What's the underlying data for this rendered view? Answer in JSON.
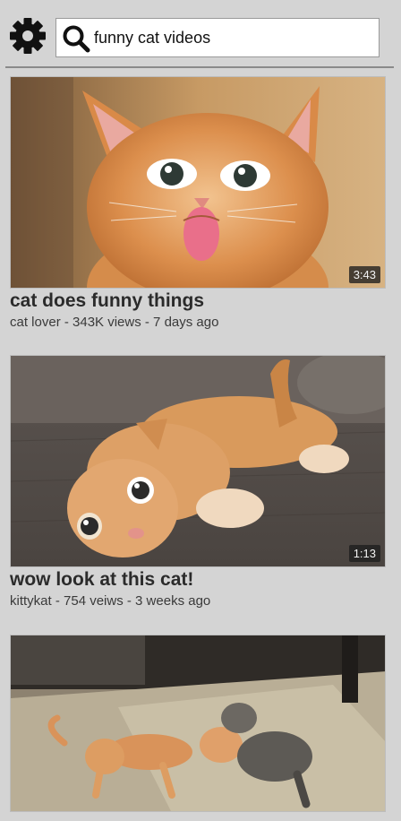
{
  "header": {
    "settings_icon": "gear-icon",
    "search_icon": "search-icon",
    "search_value": "funny cat videos"
  },
  "videos": [
    {
      "title": "cat does funny things",
      "meta": "cat lover - 343K views - 7 days ago",
      "duration": "3:43"
    },
    {
      "title": "wow look at this cat!",
      "meta": "kittykat - 754 veiws - 3 weeks ago",
      "duration": "1:13"
    },
    {
      "title": "",
      "meta": "",
      "duration": ""
    }
  ],
  "colors": {
    "background": "#d4d4d4",
    "title_text": "#2b2b2b",
    "meta_text": "#3a3a3a",
    "duration_badge": "#1e1e1e"
  }
}
